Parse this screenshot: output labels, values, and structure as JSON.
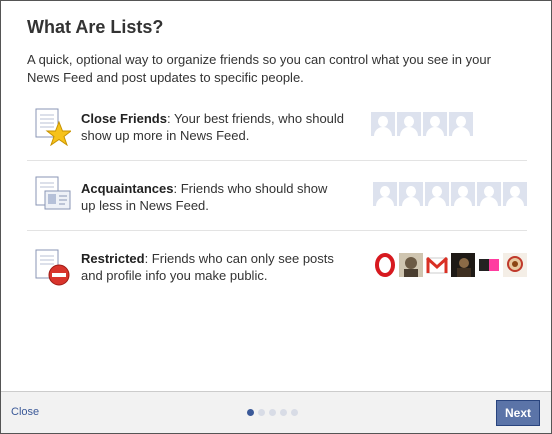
{
  "dialog": {
    "title": "What Are Lists?",
    "intro": "A quick, optional way to organize friends so you can control what you see in your News Feed and post updates to specific people."
  },
  "lists": [
    {
      "name": "Close Friends",
      "description": ": Your best friends, who should show up more in News Feed.",
      "icon": "star-list-icon",
      "thumbnails": [
        "silhouette",
        "silhouette",
        "silhouette",
        "silhouette"
      ]
    },
    {
      "name": "Acquaintances",
      "description": ": Friends who should show up less in News Feed.",
      "icon": "contact-card-list-icon",
      "thumbnails": [
        "silhouette",
        "silhouette",
        "silhouette",
        "silhouette",
        "silhouette",
        "silhouette"
      ]
    },
    {
      "name": "Restricted",
      "description": ": Friends who can only see posts and profile info you make public.",
      "icon": "restricted-list-icon",
      "thumbnails": [
        "opera-logo",
        "photo-portrait",
        "gmail-logo",
        "photo-dark",
        "pink-logo",
        "photo-figure"
      ]
    }
  ],
  "footer": {
    "close_label": "Close",
    "next_label": "Next",
    "pager": {
      "total": 5,
      "current": 1
    }
  },
  "colors": {
    "link": "#3b5998",
    "button": "#5b74a8",
    "silhouette_bg": "#dde2ee"
  }
}
